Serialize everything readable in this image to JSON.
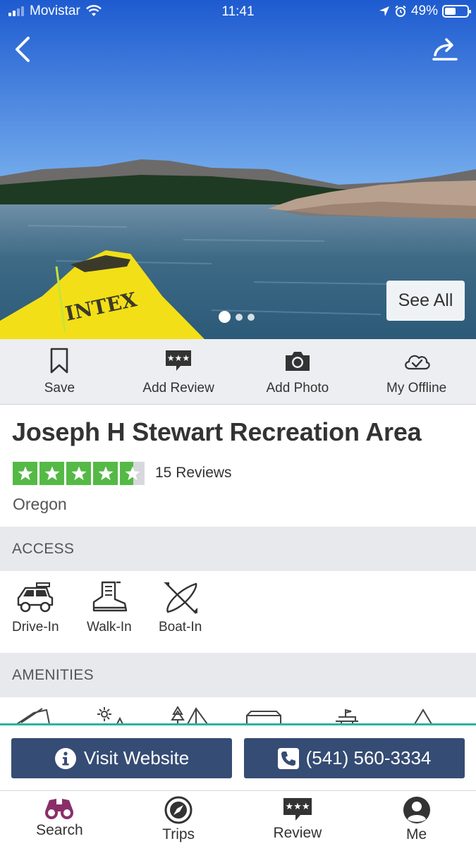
{
  "status_bar": {
    "carrier": "Movistar",
    "time": "11:41",
    "battery": "49%"
  },
  "hero": {
    "see_all_label": "See All",
    "photo_count": 3,
    "active_photo": 1,
    "kayak_text": "INTEX"
  },
  "actions": [
    {
      "label": "Save",
      "icon": "bookmark-icon"
    },
    {
      "label": "Add Review",
      "icon": "review-bubble-icon"
    },
    {
      "label": "Add Photo",
      "icon": "camera-icon"
    },
    {
      "label": "My Offline",
      "icon": "cloud-check-icon"
    }
  ],
  "place": {
    "title": "Joseph H Stewart Recreation Area",
    "rating": 4.5,
    "reviews_label": "15 Reviews",
    "location": "Oregon"
  },
  "access": {
    "header": "ACCESS",
    "items": [
      {
        "label": "Drive-In",
        "icon": "jeep-icon"
      },
      {
        "label": "Walk-In",
        "icon": "hiking-boot-icon"
      },
      {
        "label": "Boat-In",
        "icon": "kayak-icon"
      }
    ]
  },
  "amenities": {
    "header": "AMENITIES"
  },
  "cta": {
    "website_label": "Visit Website",
    "phone_label": "(541) 560-3334"
  },
  "tabs": [
    {
      "label": "Search",
      "icon": "binoculars-icon",
      "active": true
    },
    {
      "label": "Trips",
      "icon": "compass-icon"
    },
    {
      "label": "Review",
      "icon": "review-bubble-icon"
    },
    {
      "label": "Me",
      "icon": "user-avatar-icon"
    }
  ],
  "colors": {
    "star_green": "#55b946",
    "cta_navy": "#354c74",
    "accent_teal": "#2bb59a",
    "search_tab_magenta": "#8a2e6a"
  }
}
